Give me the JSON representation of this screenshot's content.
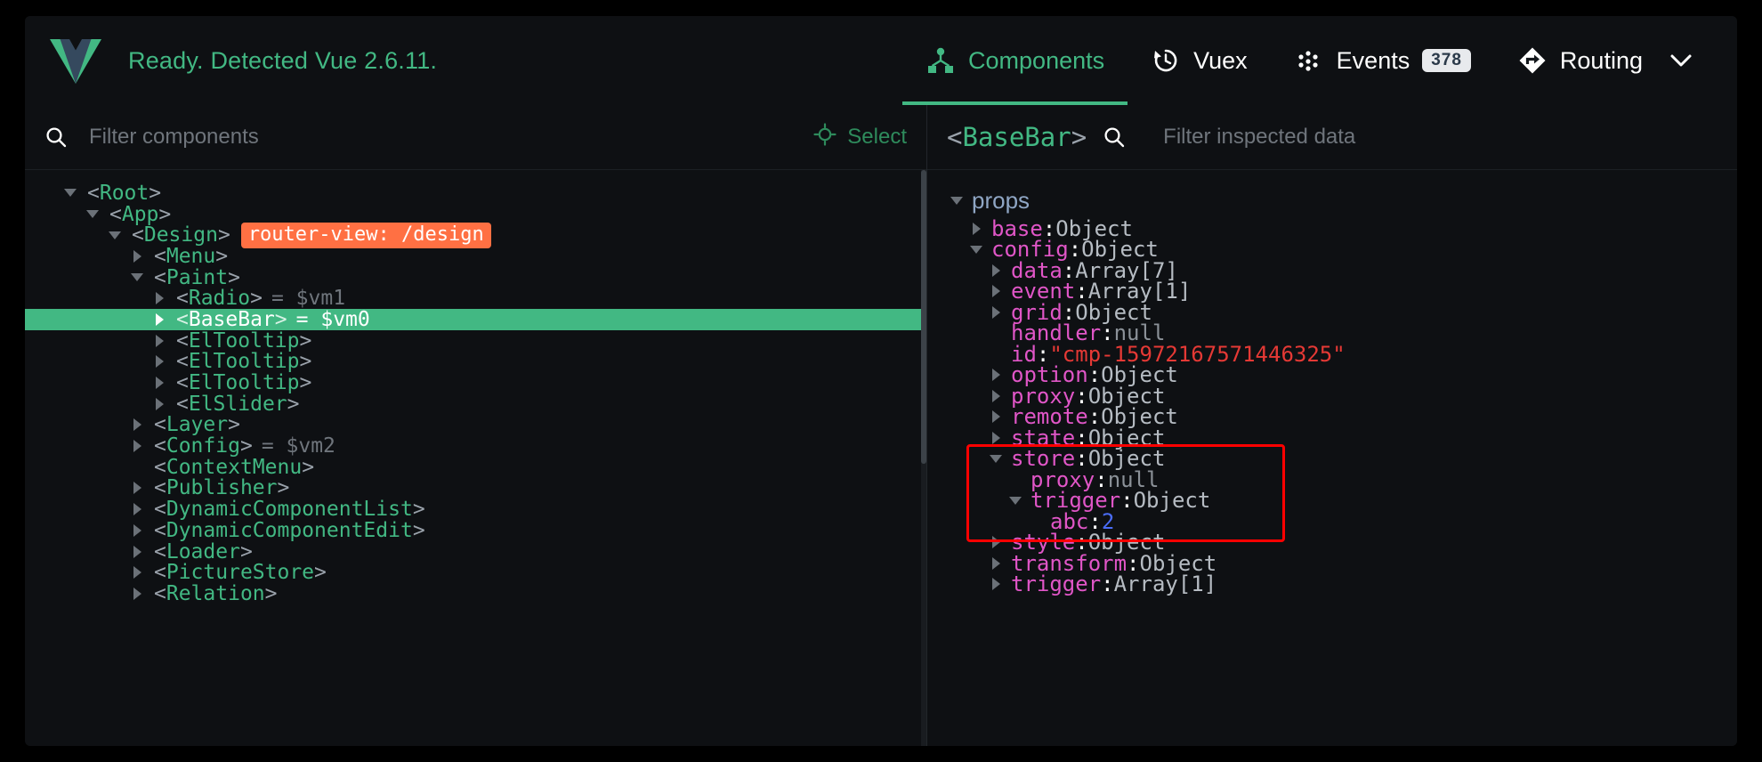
{
  "app": {
    "status_text": "Ready. Detected Vue 2.6.11.",
    "logo_name": "vue-logo"
  },
  "tabs": [
    {
      "label": "Components",
      "icon": "components-icon",
      "active": true,
      "badge": ""
    },
    {
      "label": "Vuex",
      "icon": "history-clock-icon",
      "active": false,
      "badge": ""
    },
    {
      "label": "Events",
      "icon": "events-dots-icon",
      "active": false,
      "badge": "378"
    },
    {
      "label": "Routing",
      "icon": "routing-diamond-icon",
      "active": false,
      "badge": ""
    }
  ],
  "routing_chevron": "chevron-down-icon",
  "left_pane": {
    "filter_placeholder": "Filter components",
    "filter_value": "",
    "select_label": "Select",
    "select_icon": "crosshair-icon",
    "tree": [
      {
        "indent": 0,
        "arrow": "down",
        "tag": "<Root>",
        "vm": "",
        "badge": ""
      },
      {
        "indent": 1,
        "arrow": "down",
        "tag": "<App>",
        "vm": "",
        "badge": ""
      },
      {
        "indent": 2,
        "arrow": "down",
        "tag": "<Design>",
        "vm": "",
        "badge": "router-view: /design"
      },
      {
        "indent": 3,
        "arrow": "right",
        "tag": "<Menu>",
        "vm": "",
        "badge": ""
      },
      {
        "indent": 3,
        "arrow": "down",
        "tag": "<Paint>",
        "vm": "",
        "badge": ""
      },
      {
        "indent": 4,
        "arrow": "right",
        "tag": "<Radio>",
        "vm": "= $vm1",
        "badge": ""
      },
      {
        "indent": 4,
        "arrow": "right",
        "tag": "<BaseBar>",
        "vm": "= $vm0",
        "badge": "",
        "selected": true
      },
      {
        "indent": 4,
        "arrow": "right",
        "tag": "<ElTooltip>",
        "vm": "",
        "badge": ""
      },
      {
        "indent": 4,
        "arrow": "right",
        "tag": "<ElTooltip>",
        "vm": "",
        "badge": ""
      },
      {
        "indent": 4,
        "arrow": "right",
        "tag": "<ElTooltip>",
        "vm": "",
        "badge": ""
      },
      {
        "indent": 4,
        "arrow": "right",
        "tag": "<ElSlider>",
        "vm": "",
        "badge": ""
      },
      {
        "indent": 3,
        "arrow": "right",
        "tag": "<Layer>",
        "vm": "",
        "badge": ""
      },
      {
        "indent": 3,
        "arrow": "right",
        "tag": "<Config>",
        "vm": "= $vm2",
        "badge": ""
      },
      {
        "indent": 3,
        "arrow": "none",
        "tag": "<ContextMenu>",
        "vm": "",
        "badge": ""
      },
      {
        "indent": 3,
        "arrow": "right",
        "tag": "<Publisher>",
        "vm": "",
        "badge": ""
      },
      {
        "indent": 3,
        "arrow": "right",
        "tag": "<DynamicComponentList>",
        "vm": "",
        "badge": ""
      },
      {
        "indent": 3,
        "arrow": "right",
        "tag": "<DynamicComponentEdit>",
        "vm": "",
        "badge": ""
      },
      {
        "indent": 3,
        "arrow": "right",
        "tag": "<Loader>",
        "vm": "",
        "badge": ""
      },
      {
        "indent": 3,
        "arrow": "right",
        "tag": "<PictureStore>",
        "vm": "",
        "badge": ""
      },
      {
        "indent": 3,
        "arrow": "right",
        "tag": "<Relation>",
        "vm": "",
        "badge": ""
      }
    ]
  },
  "right_pane": {
    "component_name": "BaseBar",
    "bracket_open": "<",
    "bracket_close": ">",
    "search_icon": "search-icon",
    "filter_placeholder": "Filter inspected data",
    "filter_value": "",
    "group_label": "props",
    "group_arrow": "down",
    "rows": [
      {
        "indent": 1,
        "arrow": "right",
        "key": "base",
        "value": "Object",
        "vtype": "type"
      },
      {
        "indent": 1,
        "arrow": "down",
        "key": "config",
        "value": "Object",
        "vtype": "type"
      },
      {
        "indent": 2,
        "arrow": "right",
        "key": "data",
        "value": "Array[7]",
        "vtype": "type"
      },
      {
        "indent": 2,
        "arrow": "right",
        "key": "event",
        "value": "Array[1]",
        "vtype": "type"
      },
      {
        "indent": 2,
        "arrow": "right",
        "key": "grid",
        "value": "Object",
        "vtype": "type"
      },
      {
        "indent": 2,
        "arrow": "none",
        "key": "handler",
        "value": "null",
        "vtype": "null"
      },
      {
        "indent": 2,
        "arrow": "none",
        "key": "id",
        "value": "\"cmp-15972167571446325\"",
        "vtype": "string"
      },
      {
        "indent": 2,
        "arrow": "right",
        "key": "option",
        "value": "Object",
        "vtype": "type"
      },
      {
        "indent": 2,
        "arrow": "right",
        "key": "proxy",
        "value": "Object",
        "vtype": "type"
      },
      {
        "indent": 2,
        "arrow": "right",
        "key": "remote",
        "value": "Object",
        "vtype": "type"
      },
      {
        "indent": 2,
        "arrow": "right",
        "key": "state",
        "value": "Object",
        "vtype": "type"
      },
      {
        "indent": 2,
        "arrow": "down",
        "key": "store",
        "value": "Object",
        "vtype": "type"
      },
      {
        "indent": 3,
        "arrow": "none",
        "key": "proxy",
        "value": "null",
        "vtype": "null"
      },
      {
        "indent": 3,
        "arrow": "down",
        "key": "trigger",
        "value": "Object",
        "vtype": "type"
      },
      {
        "indent": 4,
        "arrow": "none",
        "key": "abc",
        "value": "2",
        "vtype": "number"
      },
      {
        "indent": 2,
        "arrow": "right",
        "key": "style",
        "value": "Object",
        "vtype": "type"
      },
      {
        "indent": 2,
        "arrow": "right",
        "key": "transform",
        "value": "Object",
        "vtype": "type"
      },
      {
        "indent": 2,
        "arrow": "right",
        "key": "trigger",
        "value": "Array[1]",
        "vtype": "type"
      }
    ],
    "annotation": {
      "name": "red-highlight-box",
      "color": "#ff0000"
    }
  },
  "colors": {
    "accent_green": "#42b883",
    "router_badge": "#ff7043",
    "key_magenta": "#e056c7",
    "string_red": "#e53935",
    "number_blue": "#4a6cf7",
    "annotation_red": "#ff0000",
    "background": "#0e1013"
  }
}
